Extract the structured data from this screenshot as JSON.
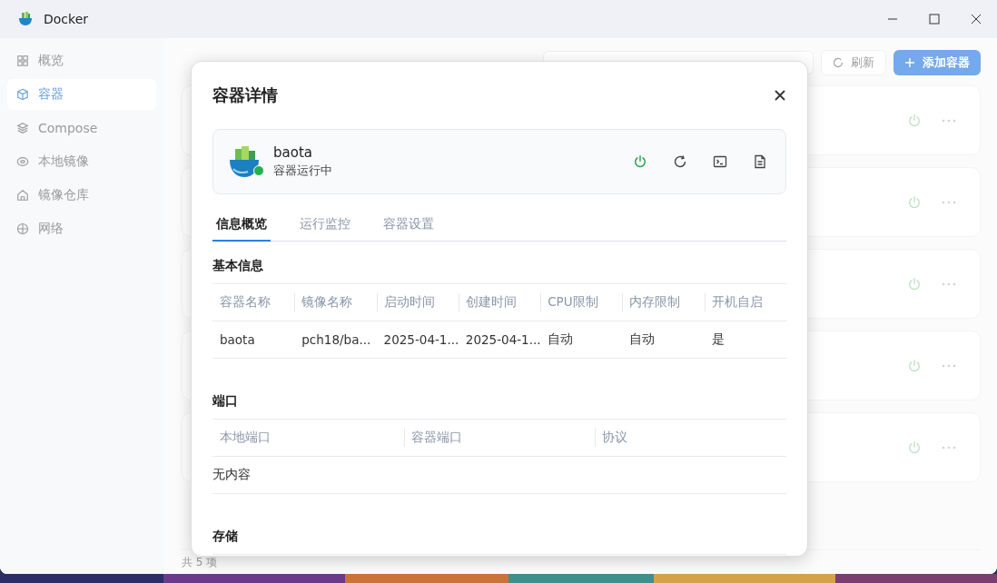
{
  "window": {
    "title": "Docker"
  },
  "sidebar": {
    "items": [
      {
        "label": "概览",
        "selected": false
      },
      {
        "label": "容器",
        "selected": true
      },
      {
        "label": "Compose",
        "selected": false
      },
      {
        "label": "本地镜像",
        "selected": false
      },
      {
        "label": "镜像仓库",
        "selected": false
      },
      {
        "label": "网络",
        "selected": false
      }
    ]
  },
  "main": {
    "refresh_button": "刷新",
    "add_button": "添加容器",
    "cards": [
      {
        "running": true
      },
      {
        "running": true
      },
      {
        "running": true
      },
      {
        "running": true
      },
      {
        "running": true
      }
    ],
    "footer": "共 5 项"
  },
  "dialog": {
    "title": "容器详情",
    "container": {
      "name": "baota",
      "status": "容器运行中",
      "running": true
    },
    "tabs": [
      {
        "label": "信息概览",
        "selected": true
      },
      {
        "label": "运行监控",
        "selected": false
      },
      {
        "label": "容器设置",
        "selected": false
      }
    ],
    "sections": [
      {
        "title": "基本信息",
        "columns": [
          "容器名称",
          "镜像名称",
          "启动时间",
          "创建时间",
          "CPU限制",
          "内存限制",
          "开机自启"
        ],
        "rows": [
          [
            "baota",
            "pch18/ba...",
            "2025-04-1...",
            "2025-04-1...",
            "自动",
            "自动",
            "是"
          ]
        ]
      },
      {
        "title": "端口",
        "columns": [
          "本地端口",
          "容器端口",
          "协议"
        ],
        "empty_text": "无内容"
      },
      {
        "title": "存储"
      }
    ]
  }
}
